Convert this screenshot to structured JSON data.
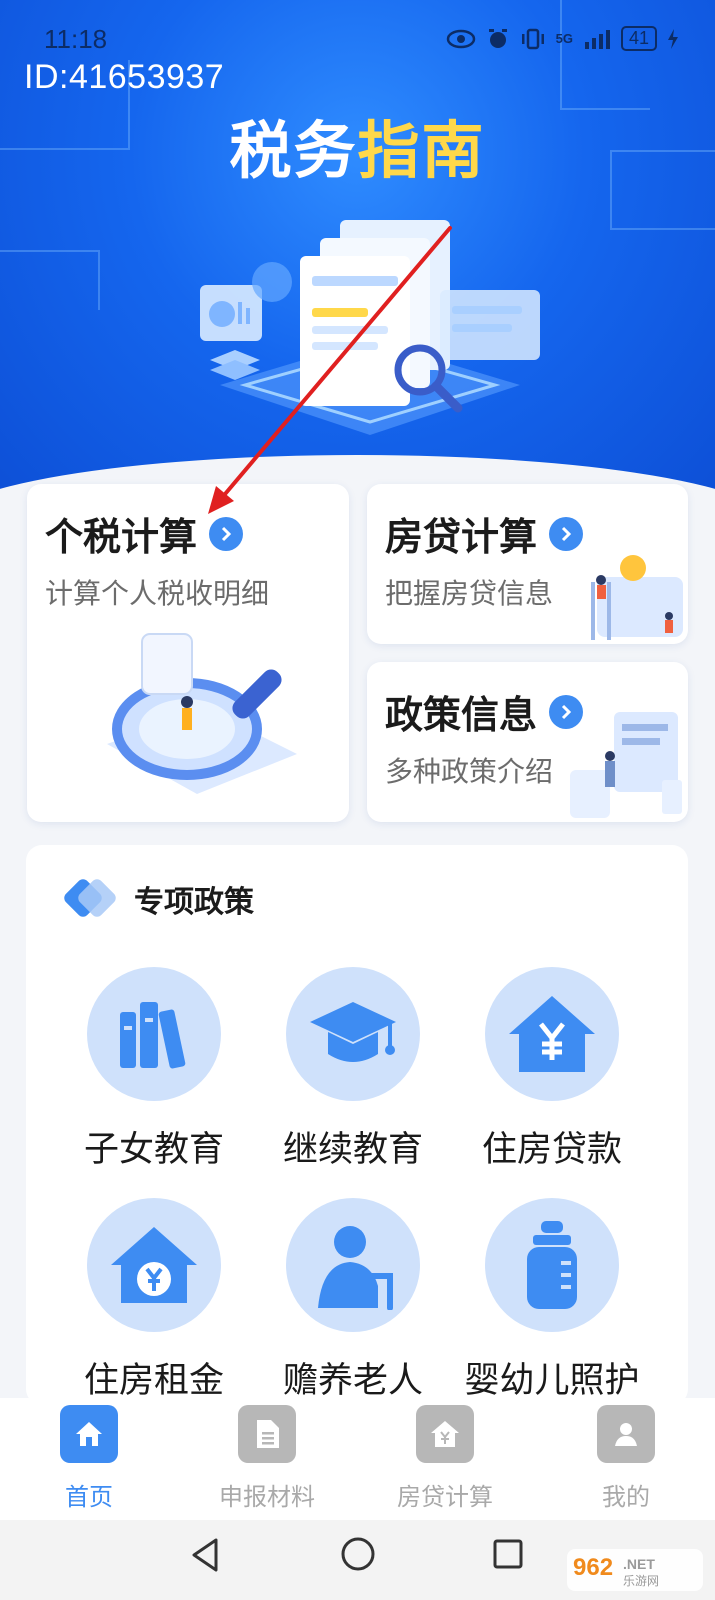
{
  "status_bar": {
    "time": "11:18",
    "network": "5G",
    "battery": "41"
  },
  "watermark": {
    "id_text": "ID:41653937"
  },
  "hero": {
    "title_white": "税务",
    "title_yellow": "指南"
  },
  "cards": [
    {
      "title": "个税计算",
      "subtitle": "计算个人税收明细"
    },
    {
      "title": "房贷计算",
      "subtitle": "把握房贷信息"
    },
    {
      "title": "政策信息",
      "subtitle": "多种政策介绍"
    }
  ],
  "policies": {
    "title": "专项政策",
    "items": [
      {
        "label": "子女教育",
        "icon": "books-icon"
      },
      {
        "label": "继续教育",
        "icon": "graduation-cap-icon"
      },
      {
        "label": "住房贷款",
        "icon": "house-yen-icon"
      },
      {
        "label": "住房租金",
        "icon": "house-coin-icon"
      },
      {
        "label": "赡养老人",
        "icon": "elderly-person-icon"
      },
      {
        "label": "婴幼儿照护",
        "icon": "baby-bottle-icon"
      }
    ]
  },
  "tabs": [
    {
      "label": "首页",
      "icon": "home-icon",
      "active": true
    },
    {
      "label": "申报材料",
      "icon": "document-icon",
      "active": false
    },
    {
      "label": "房贷计算",
      "icon": "house-yen-icon",
      "active": false
    },
    {
      "label": "我的",
      "icon": "user-icon",
      "active": false
    }
  ],
  "colors": {
    "primary": "#3e8cf2",
    "hero_blue": "#1566ee",
    "accent_yellow": "#ffd84a",
    "annotation_red": "#e02020"
  }
}
